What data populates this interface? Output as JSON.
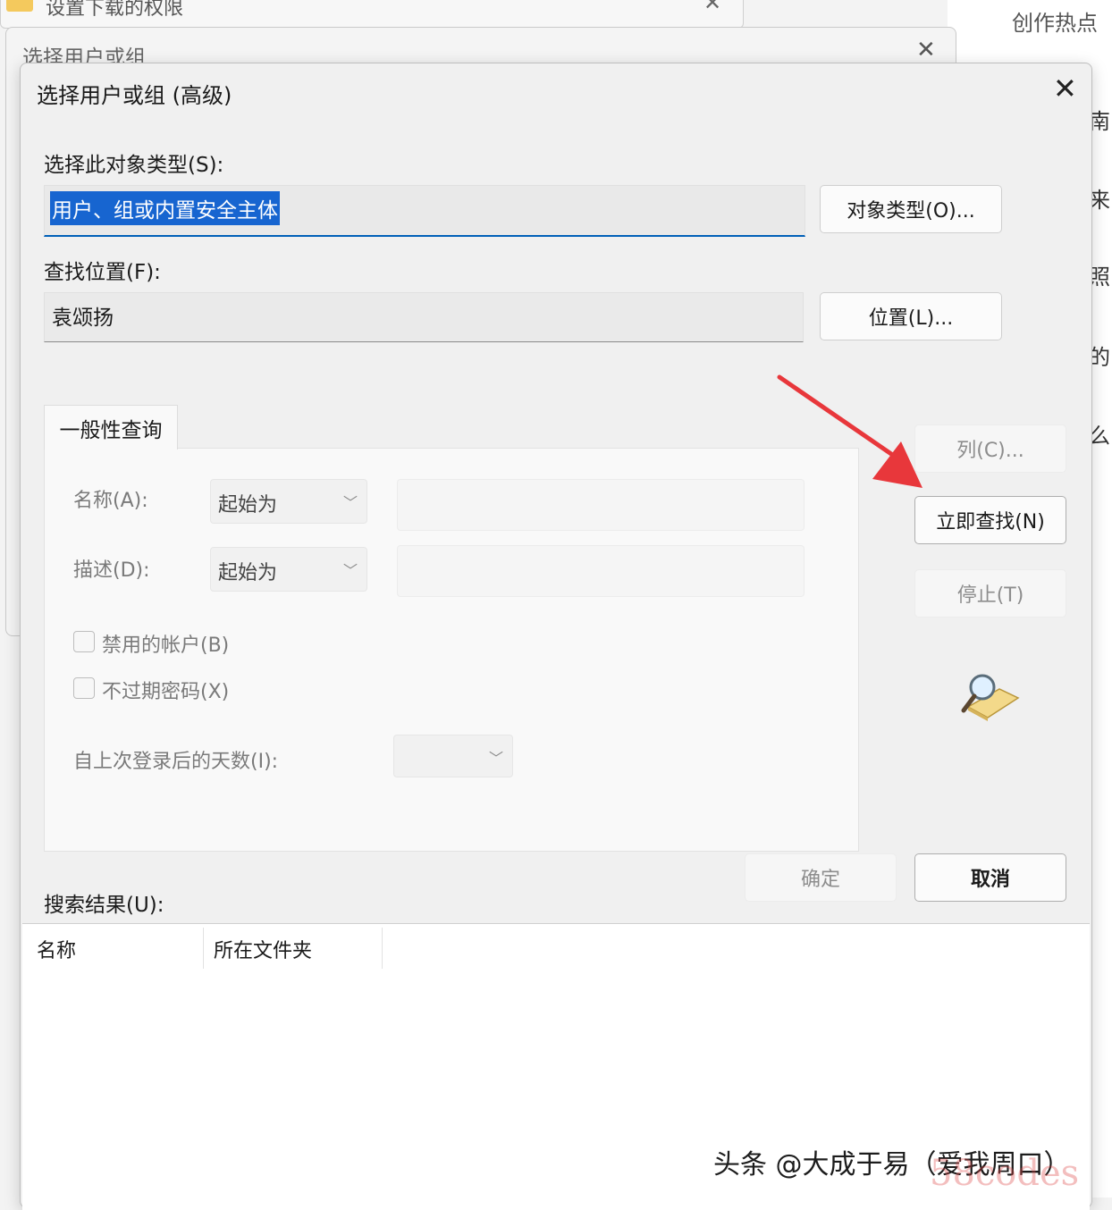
{
  "background": {
    "top_window_title": "设置下载的权限",
    "middle_window_title": "选择用户或组",
    "right_panel_heading": "创作热点",
    "right_panel_chars": [
      "南",
      "来",
      "照",
      "的",
      "么"
    ]
  },
  "dialog": {
    "title": "选择用户或组 (高级)",
    "object_type_label": "选择此对象类型(S):",
    "object_type_value": "用户、组或内置安全主体",
    "object_types_button": "对象类型(O)...",
    "location_label": "查找位置(F):",
    "location_value": "袁颂扬",
    "location_button": "位置(L)...",
    "tab_label": "一般性查询",
    "name_label": "名称(A):",
    "name_mode": "起始为",
    "description_label": "描述(D):",
    "description_mode": "起始为",
    "disabled_accounts_label": "禁用的帐户(B)",
    "non_expiring_password_label": "不过期密码(X)",
    "days_since_logon_label": "自上次登录后的天数(I):",
    "columns_button": "列(C)...",
    "find_now_button": "立即查找(N)",
    "stop_button": "停止(T)",
    "ok_button": "确定",
    "cancel_button": "取消",
    "results_label": "搜索结果(U):",
    "results_columns": [
      "名称",
      "所在文件夹"
    ]
  },
  "annotation": {
    "arrow_color": "#e8373b"
  },
  "watermark": {
    "text": "头条 @大成于易（爱我周口）",
    "overlay": "58codes"
  }
}
